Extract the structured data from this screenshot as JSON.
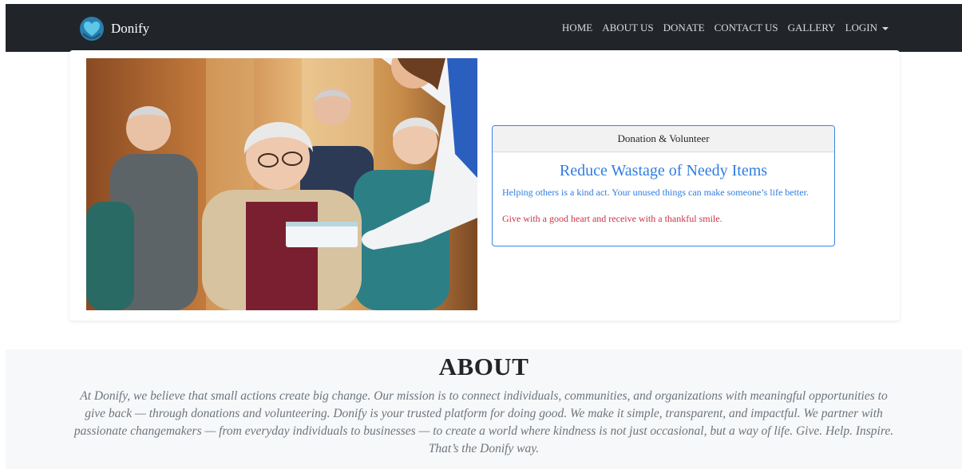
{
  "brand": {
    "name": "Donify",
    "logo_icon": "heart-hands-icon"
  },
  "nav": {
    "items": [
      "HOME",
      "ABOUT US",
      "DONATE",
      "CONTACT US",
      "GALLERY"
    ],
    "login": "LOGIN"
  },
  "hero": {
    "image_icon": "photo-elderly-donation"
  },
  "info_card": {
    "header": "Donation & Volunteer",
    "title": "Reduce Wastage of Needy Items",
    "text": "Helping others is a kind act. Your unused things can make someone’s life better.",
    "quote": "Give with a good heart and receive with a thankful smile."
  },
  "about": {
    "title": "ABOUT",
    "text": "At Donify, we believe that small actions create big change. Our mission is to connect individuals, communities, and organizations with meaningful opportunities to give back — through donations and volunteering. Donify is your trusted platform for doing good. We make it simple, transparent, and impactful. We partner with passionate changemakers — from everyday individuals to businesses — to create a world where kindness is not just occasional, but a way of life. Give. Help. Inspire. That’s the Donify way."
  },
  "colors": {
    "navbar": "#212529",
    "accent": "#2f7de0",
    "quote": "#cc3344",
    "about_bg": "#f7f8f9"
  }
}
